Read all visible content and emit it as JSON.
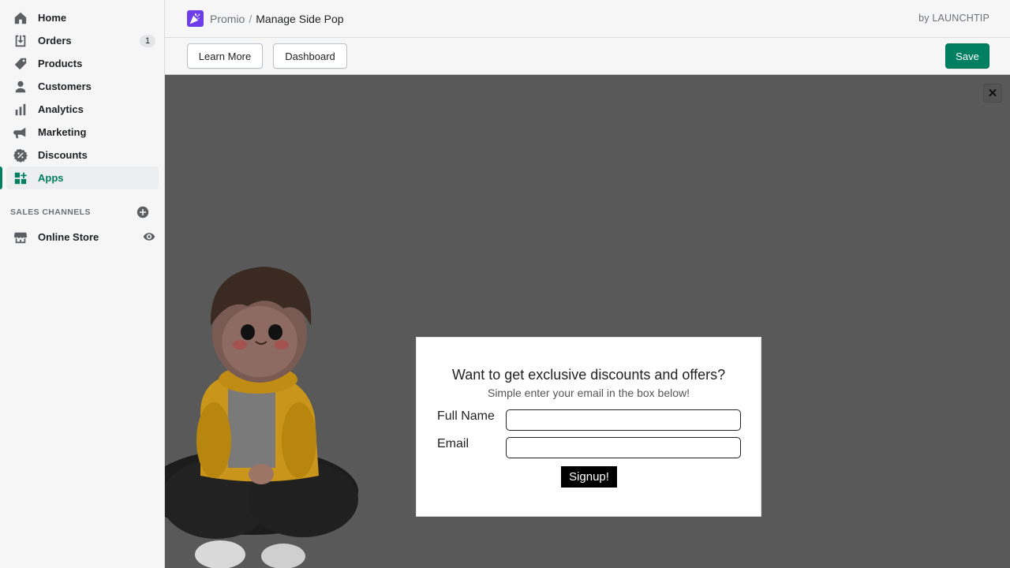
{
  "sidebar": {
    "items": [
      {
        "label": "Home",
        "icon": "home-icon"
      },
      {
        "label": "Orders",
        "icon": "orders-icon",
        "badge": "1"
      },
      {
        "label": "Products",
        "icon": "tag-icon"
      },
      {
        "label": "Customers",
        "icon": "person-icon"
      },
      {
        "label": "Analytics",
        "icon": "bar-chart-icon"
      },
      {
        "label": "Marketing",
        "icon": "megaphone-icon"
      },
      {
        "label": "Discounts",
        "icon": "discount-icon"
      },
      {
        "label": "Apps",
        "icon": "apps-icon",
        "active": true
      }
    ],
    "sales_channels": {
      "title": "SALES CHANNELS",
      "items": [
        {
          "label": "Online Store",
          "icon": "store-icon"
        }
      ]
    }
  },
  "header": {
    "app_name": "Promio",
    "separator": "/",
    "page_title": "Manage Side Pop",
    "byline": "by LAUNCHTIP"
  },
  "toolbar": {
    "learn_more_label": "Learn More",
    "dashboard_label": "Dashboard",
    "save_label": "Save"
  },
  "preview": {
    "close_label": "✕",
    "popup": {
      "title": "Want to get exclusive discounts and offers?",
      "subtitle": "Simple enter your email in the box below!",
      "full_name_label": "Full Name",
      "full_name_value": "",
      "email_label": "Email",
      "email_value": "",
      "signup_label": "Signup!"
    }
  },
  "colors": {
    "accent": "#008060",
    "app_logo": "#6c3de8",
    "canvas_bg": "#595959"
  }
}
